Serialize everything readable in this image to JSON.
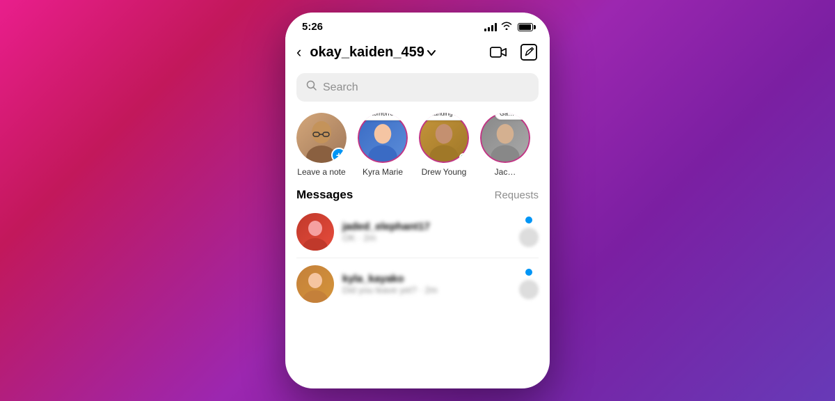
{
  "background": {
    "gradient": "135deg, #e91e8c 0%, #c2185b 20%, #9c27b0 50%, #7b1fa2 70%, #673ab7 100%"
  },
  "statusBar": {
    "time": "5:26"
  },
  "navBar": {
    "back_label": "‹",
    "username": "okay_kaiden_459",
    "chevron": "∨",
    "camera_icon": "camera",
    "edit_icon": "edit"
  },
  "search": {
    "placeholder": "Search"
  },
  "stories": [
    {
      "id": "own",
      "name": "Leave a note",
      "has_add": true,
      "note_bubble": null,
      "online": false,
      "avatar_type": "own"
    },
    {
      "id": "kyra",
      "name": "Kyra Marie",
      "has_add": false,
      "note_bubble": "Why is tomorrow Monday!? 😤",
      "online": false,
      "avatar_type": "kyra"
    },
    {
      "id": "drew",
      "name": "Drew Young",
      "has_add": false,
      "note_bubble": "Finally landing in NYC! ❤️",
      "online": true,
      "avatar_type": "drew"
    },
    {
      "id": "jack",
      "name": "Jac…",
      "has_add": false,
      "note_bubble": "Ga… w…",
      "online": false,
      "avatar_type": "jack"
    }
  ],
  "messages": {
    "title": "Messages",
    "requests_label": "Requests",
    "items": [
      {
        "username": "jaded_elephant17",
        "preview": "OK · 2m"
      },
      {
        "username": "kyla_kayako",
        "preview": "Did you leave yet? · 2m"
      }
    ]
  }
}
